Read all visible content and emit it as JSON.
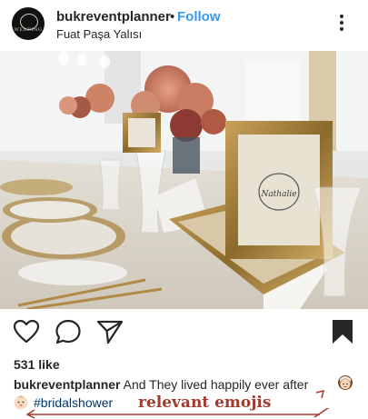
{
  "post": {
    "username": "bukreventplanner",
    "separator": "•",
    "follow_label": "Follow",
    "location": "Fuat Paşa Yalısı",
    "avatar_brand": "WEDDING",
    "menu_icon": "more-vertical-icon"
  },
  "photo": {
    "frame_text": "Nathalie",
    "description_icon": "wedding-table-photo"
  },
  "actions": {
    "like_icon": "heart-icon",
    "comment_icon": "comment-icon",
    "share_icon": "paper-plane-icon",
    "save_icon": "bookmark-icon"
  },
  "likes": {
    "text": "531 like"
  },
  "caption": {
    "username": "bukreventplanner",
    "text": "And They lived happily ever after",
    "hashtag": "#bridalshower"
  },
  "annotation": {
    "label": "relevant emojis",
    "color": "#a33a2e"
  }
}
